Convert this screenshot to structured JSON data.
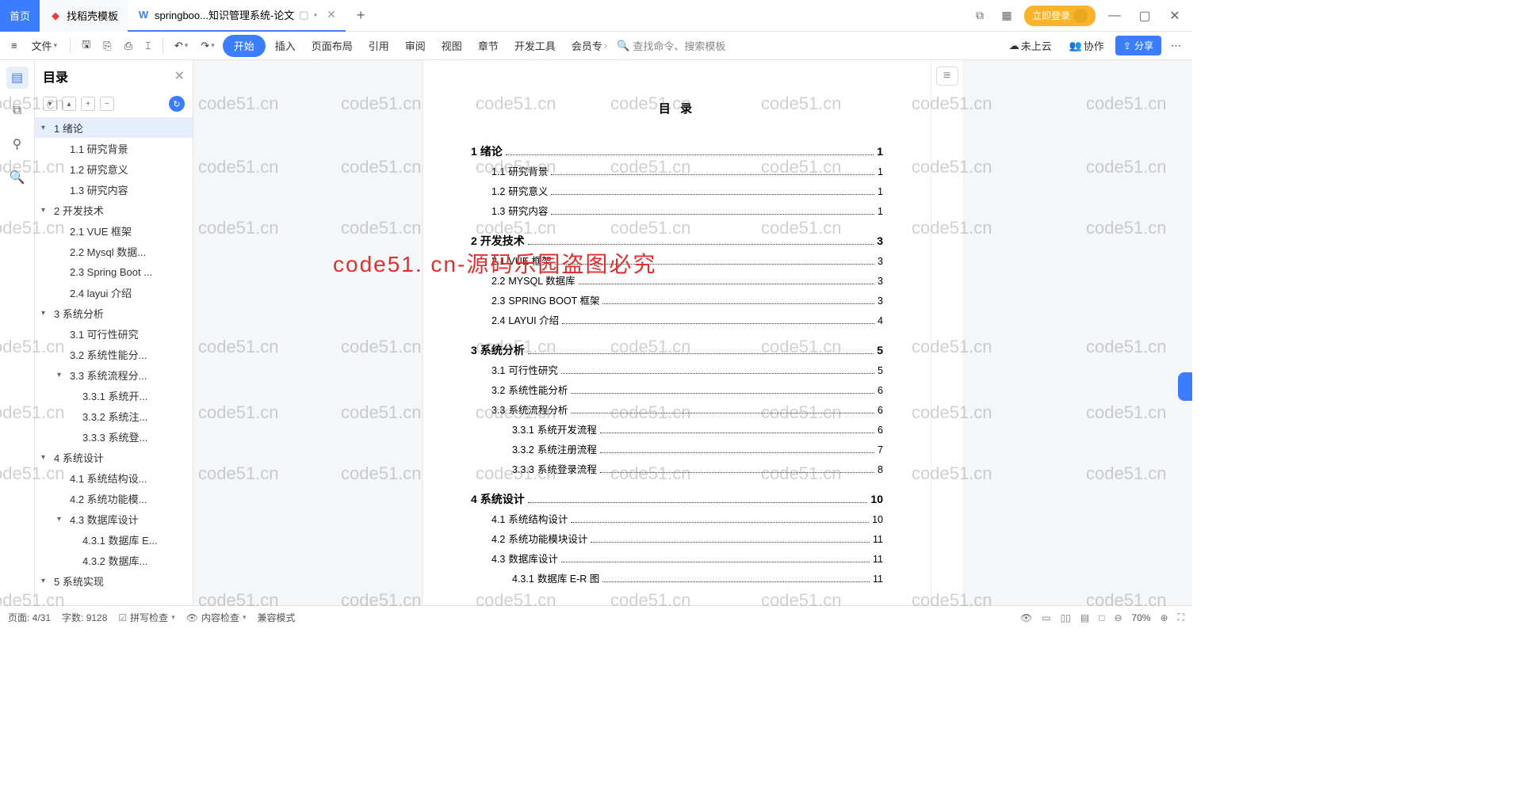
{
  "tabs": {
    "home": "首页",
    "template": "找稻壳模板",
    "active": "springboo...知识管理系统-论文",
    "add": "+"
  },
  "titlebar": {
    "login": "立即登录"
  },
  "toolbar": {
    "file": "文件",
    "start": "开始",
    "insert": "插入",
    "layout": "页面布局",
    "reference": "引用",
    "review": "审阅",
    "view": "视图",
    "chapter": "章节",
    "devtools": "开发工具",
    "member": "会员专",
    "search_placeholder": "查找命令、搜索模板",
    "cloud": "未上云",
    "collab": "协作",
    "share": "分享"
  },
  "outline": {
    "title": "目录",
    "items": [
      {
        "lv": 0,
        "expand": true,
        "label": "1 绪论",
        "selected": true
      },
      {
        "lv": 1,
        "label": "1.1 研究背景"
      },
      {
        "lv": 1,
        "label": "1.2 研究意义"
      },
      {
        "lv": 1,
        "label": "1.3 研究内容"
      },
      {
        "lv": 0,
        "expand": true,
        "label": "2 开发技术"
      },
      {
        "lv": 1,
        "label": "2.1 VUE 框架"
      },
      {
        "lv": 1,
        "label": "2.2 Mysql 数据..."
      },
      {
        "lv": 1,
        "label": "2.3 Spring Boot ..."
      },
      {
        "lv": 1,
        "label": "2.4 layui 介绍"
      },
      {
        "lv": 0,
        "expand": true,
        "label": "3 系统分析"
      },
      {
        "lv": 1,
        "label": "3.1 可行性研究"
      },
      {
        "lv": 1,
        "label": "3.2 系统性能分..."
      },
      {
        "lv": 1,
        "expand": true,
        "label": "3.3 系统流程分..."
      },
      {
        "lv": 2,
        "label": "3.3.1 系统开..."
      },
      {
        "lv": 2,
        "label": "3.3.2 系统注..."
      },
      {
        "lv": 2,
        "label": "3.3.3 系统登..."
      },
      {
        "lv": 0,
        "expand": true,
        "label": "4 系统设计"
      },
      {
        "lv": 1,
        "label": "4.1 系统结构设..."
      },
      {
        "lv": 1,
        "label": "4.2 系统功能模..."
      },
      {
        "lv": 1,
        "expand": true,
        "label": "4.3 数据库设计"
      },
      {
        "lv": 2,
        "label": "4.3.1 数据库 E..."
      },
      {
        "lv": 2,
        "label": "4.3.2 数据库..."
      },
      {
        "lv": 0,
        "expand": true,
        "label": "5 系统实现"
      }
    ]
  },
  "document": {
    "title": "目 录",
    "toc": [
      {
        "lv": 1,
        "num": "1",
        "text": "绪论",
        "page": "1"
      },
      {
        "lv": 2,
        "num": "1.1",
        "text": "研究背景",
        "page": "1"
      },
      {
        "lv": 2,
        "num": "1.2",
        "text": "研究意义",
        "page": "1"
      },
      {
        "lv": 2,
        "num": "1.3",
        "text": "研究内容",
        "page": "1"
      },
      {
        "lv": 1,
        "num": "2",
        "text": "开发技术",
        "page": "3"
      },
      {
        "lv": 2,
        "num": "2.1",
        "text": "VUE 框架",
        "page": "3"
      },
      {
        "lv": 2,
        "num": "2.2",
        "text": "MYSQL 数据库",
        "page": "3"
      },
      {
        "lv": 2,
        "num": "2.3",
        "text": "SPRING BOOT 框架",
        "page": "3"
      },
      {
        "lv": 2,
        "num": "2.4",
        "text": "LAYUI 介绍",
        "page": "4"
      },
      {
        "lv": 1,
        "num": "3",
        "text": "系统分析",
        "page": "5"
      },
      {
        "lv": 2,
        "num": "3.1",
        "text": "可行性研究",
        "page": "5"
      },
      {
        "lv": 2,
        "num": "3.2",
        "text": "系统性能分析",
        "page": "6"
      },
      {
        "lv": 2,
        "num": "3.3",
        "text": "系统流程分析",
        "page": "6"
      },
      {
        "lv": 3,
        "num": "3.3.1",
        "text": "系统开发流程",
        "page": "6"
      },
      {
        "lv": 3,
        "num": "3.3.2",
        "text": "系统注册流程",
        "page": "7"
      },
      {
        "lv": 3,
        "num": "3.3.3",
        "text": "系统登录流程",
        "page": "8"
      },
      {
        "lv": 1,
        "num": "4",
        "text": "系统设计",
        "page": "10"
      },
      {
        "lv": 2,
        "num": "4.1",
        "text": "系统结构设计",
        "page": "10"
      },
      {
        "lv": 2,
        "num": "4.2",
        "text": "系统功能模块设计",
        "page": "11"
      },
      {
        "lv": 2,
        "num": "4.3",
        "text": "数据库设计",
        "page": "11"
      },
      {
        "lv": 3,
        "num": "4.3.1",
        "text": "数据库 E-R 图",
        "page": "11"
      }
    ]
  },
  "watermark": "code51.cn",
  "watermark_center": "code51. cn-源码乐园盗图必究",
  "statusbar": {
    "page": "页面: 4/31",
    "words": "字数: 9128",
    "spell": "拼写检查",
    "content": "内容检查",
    "compat": "兼容模式",
    "zoom": "70%"
  }
}
